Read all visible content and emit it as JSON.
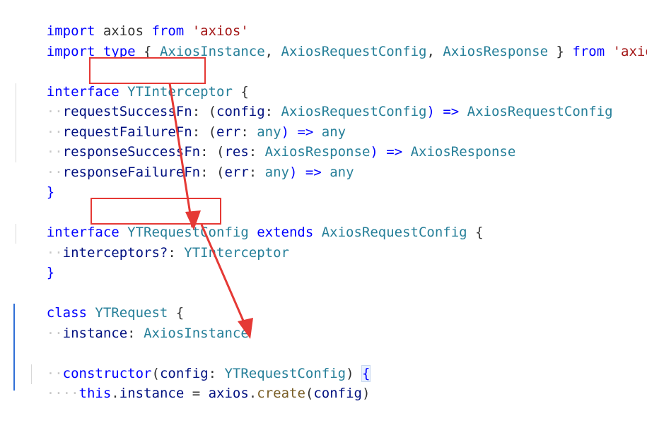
{
  "code": {
    "line1": {
      "kw_import": "import",
      "ident": " axios ",
      "kw_from": "from",
      "str": " 'axios'"
    },
    "line2": {
      "kw_import": "import",
      "kw_type": " type",
      "brace_open": " { ",
      "t1": "AxiosInstance",
      "c1": ", ",
      "t2": "AxiosRequestConfig",
      "c2": ", ",
      "t3": "AxiosResponse",
      "brace_close": " } ",
      "kw_from": "from",
      "str": " 'axios'"
    },
    "line3": {
      "kw": "interface",
      "name": "YTInterceptor",
      "brace": " {"
    },
    "line4": {
      "prop": "requestSuccessFn",
      "p1": ": (",
      "arg": "config",
      "p2": ": ",
      "t1": "AxiosRequestConfig",
      "p3": ") => ",
      "t2": "AxiosRequestConfig"
    },
    "line5": {
      "prop": "requestFailureFn",
      "p1": ": (",
      "arg": "err",
      "p2": ": ",
      "t1": "any",
      "p3": ") => ",
      "t2": "any"
    },
    "line6": {
      "prop": "responseSuccessFn",
      "p1": ": (",
      "arg": "res",
      "p2": ": ",
      "t1": "AxiosResponse",
      "p3": ") => ",
      "t2": "AxiosResponse"
    },
    "line7": {
      "prop": "responseFailureFn",
      "p1": ": (",
      "arg": "err",
      "p2": ": ",
      "t1": "any",
      "p3": ") => ",
      "t2": "any"
    },
    "line8": {
      "brace": "}"
    },
    "line9": {
      "kw": "interface",
      "name": "YTRequestConfig",
      "kw_ext": " extends ",
      "t1": "AxiosRequestConfig",
      "brace": " {"
    },
    "line10": {
      "prop": "interceptors?",
      "p1": ": ",
      "t1": "YTInterceptor"
    },
    "line11": {
      "brace": "}"
    },
    "line12": {
      "kw": "class",
      "name": " YTRequest",
      "brace": " {"
    },
    "line13": {
      "prop": "instance",
      "p1": ": ",
      "t1": "AxiosInstance"
    },
    "line14": {
      "kw": "constructor",
      "p1": "(",
      "arg": "config",
      "p2": ": ",
      "t1": "YTRequestConfig",
      "p3": ") ",
      "brace": "{"
    },
    "line15": {
      "kw_this": "this",
      "p1": ".",
      "prop": "instance",
      "p2": " = ",
      "obj": "axios",
      "p3": ".",
      "fn": "create",
      "p4": "(",
      "arg": "config",
      "p5": ")"
    }
  },
  "colors": {
    "keyword": "#0000ff",
    "string": "#a31515",
    "type": "#267f99",
    "property": "#001080",
    "function": "#795e26",
    "annotation": "#e53935"
  }
}
